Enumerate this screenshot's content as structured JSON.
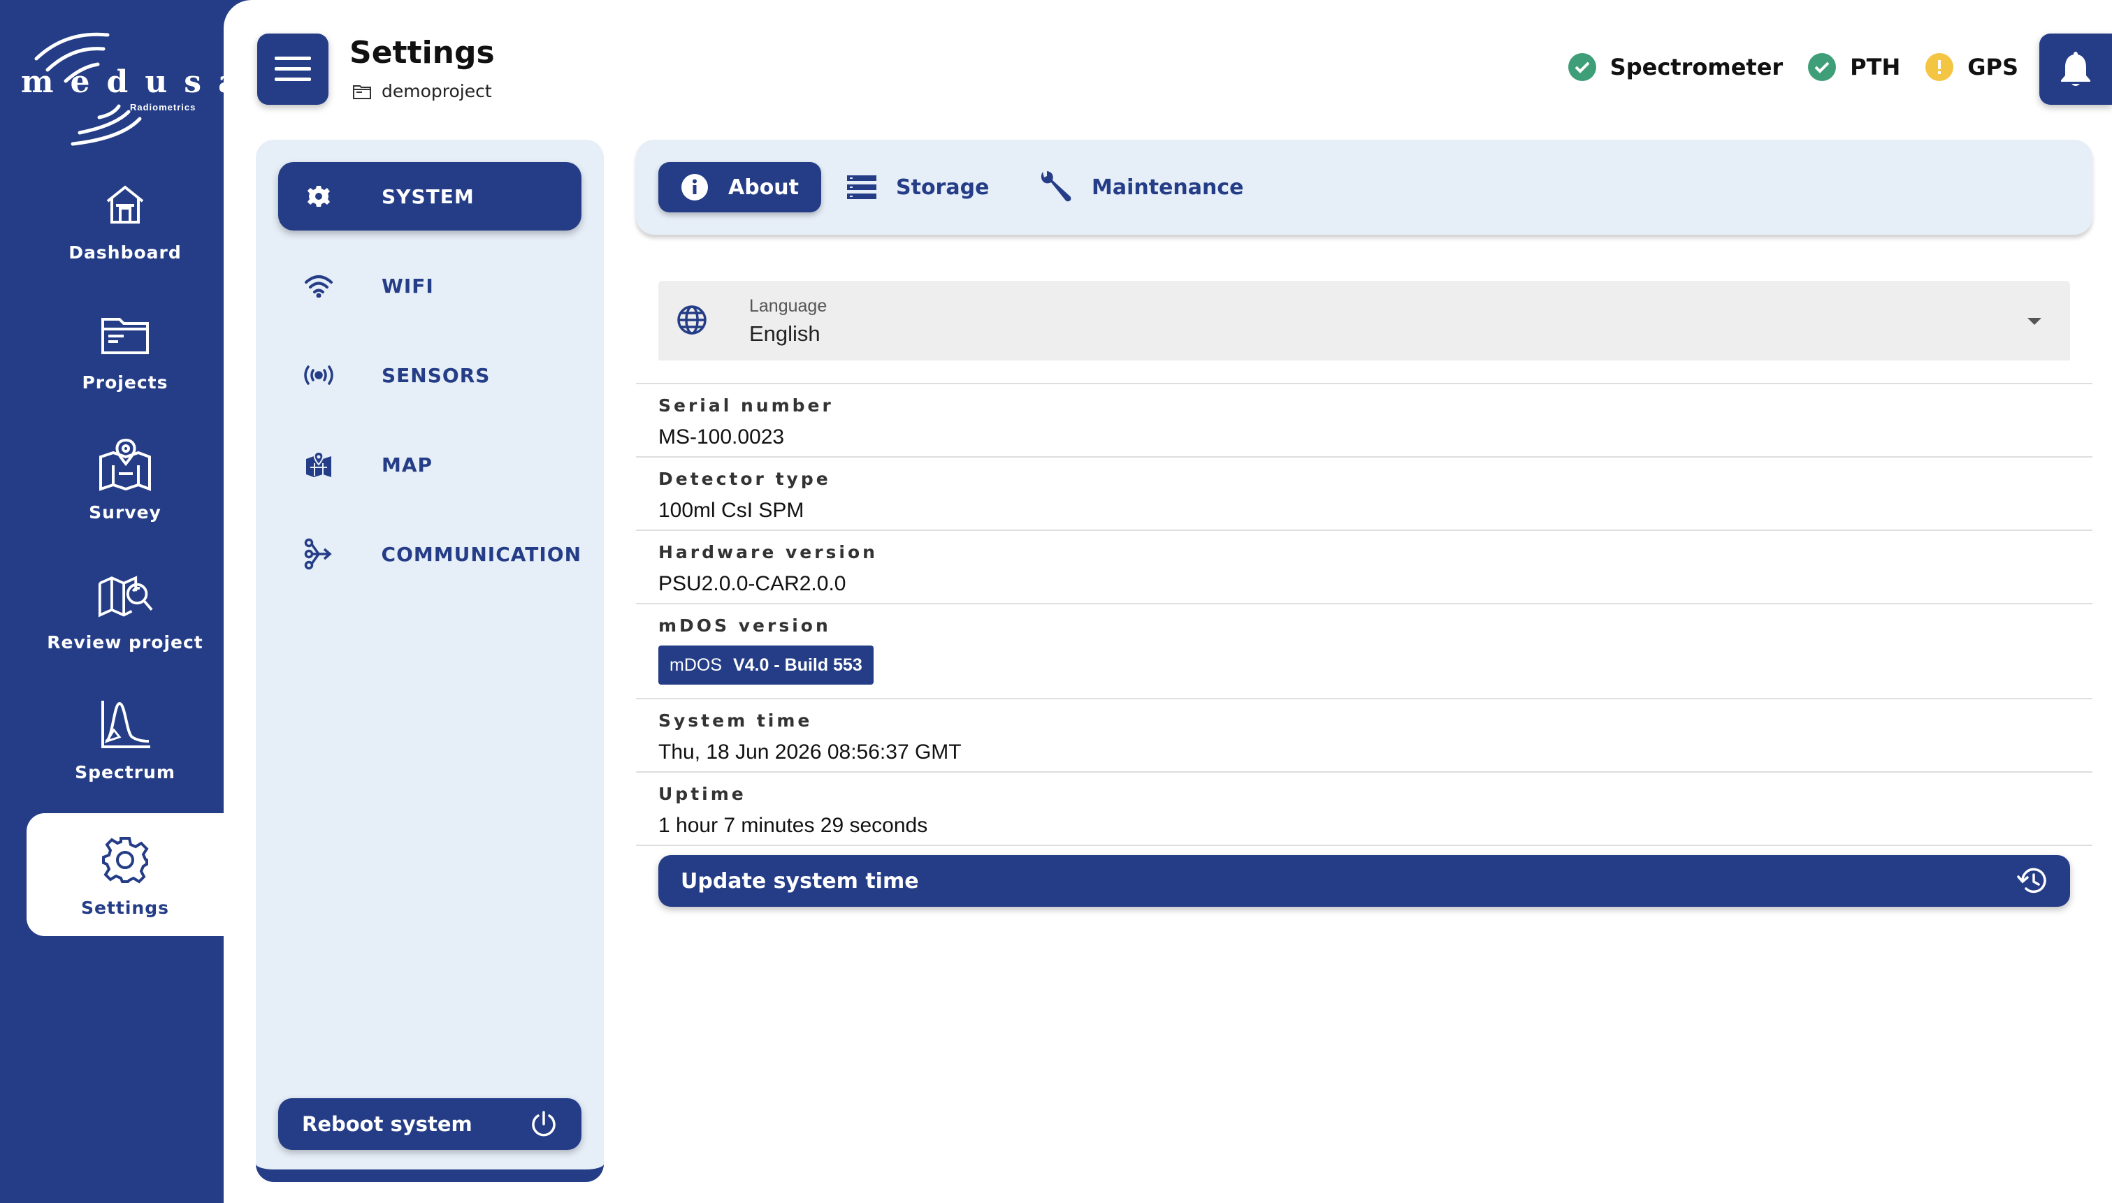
{
  "brand": {
    "name": "medusa",
    "sub": "Radiometrics",
    "color": "#243d86"
  },
  "nav": {
    "items": [
      {
        "label": "Dashboard",
        "icon": "home-icon"
      },
      {
        "label": "Projects",
        "icon": "folder-icon"
      },
      {
        "label": "Survey",
        "icon": "survey-map-icon"
      },
      {
        "label": "Review project",
        "icon": "review-map-icon"
      },
      {
        "label": "Spectrum",
        "icon": "spectrum-icon"
      },
      {
        "label": "Settings",
        "icon": "gear-icon",
        "active": true
      }
    ]
  },
  "header": {
    "title": "Settings",
    "project": "demoproject",
    "status": [
      {
        "label": "Spectrometer",
        "state": "ok",
        "color": "#3e9e78"
      },
      {
        "label": "PTH",
        "state": "ok",
        "color": "#3e9e78"
      },
      {
        "label": "GPS",
        "state": "warning",
        "color": "#f4c542"
      }
    ]
  },
  "settings_menu": {
    "items": [
      {
        "label": "SYSTEM",
        "icon": "gear-icon",
        "active": true
      },
      {
        "label": "WIFI",
        "icon": "wifi-icon"
      },
      {
        "label": "SENSORS",
        "icon": "sensor-icon"
      },
      {
        "label": "MAP",
        "icon": "map-icon"
      },
      {
        "label": "COMMUNICATION",
        "icon": "communication-icon"
      }
    ],
    "reboot_label": "Reboot system"
  },
  "tabs": [
    {
      "label": "About",
      "icon": "info-icon",
      "active": true
    },
    {
      "label": "Storage",
      "icon": "storage-icon"
    },
    {
      "label": "Maintenance",
      "icon": "wrench-icon"
    }
  ],
  "language": {
    "caption": "Language",
    "value": "English"
  },
  "about": {
    "serial_label": "Serial number",
    "serial_value": "MS-100.0023",
    "detector_label": "Detector type",
    "detector_value": "100ml CsI SPM",
    "hardware_label": "Hardware version",
    "hardware_value": "PSU2.0.0-CAR2.0.0",
    "mdos_label": "mDOS version",
    "mdos_prefix": "mDOS",
    "mdos_build": "V4.0 - Build 553",
    "time_label": "System time",
    "time_value": "Thu, 18 Jun 2026 08:56:37 GMT",
    "uptime_label": "Uptime",
    "uptime_value": "1 hour 7 minutes 29 seconds"
  },
  "update_time_label": "Update system time"
}
